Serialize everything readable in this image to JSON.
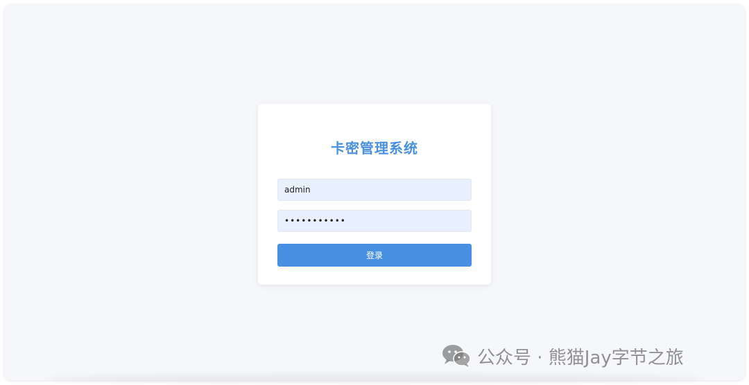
{
  "login": {
    "title": "卡密管理系统",
    "username_value": "admin",
    "password_value": "•••••••••••",
    "submit_label": "登录"
  },
  "watermark": {
    "text": "公众号 · 熊猫Jay字节之旅",
    "icon": "wechat-icon"
  },
  "colors": {
    "accent": "#4a90e2",
    "input_bg": "#e8f0fe",
    "page_bg": "#f5f7fb"
  }
}
